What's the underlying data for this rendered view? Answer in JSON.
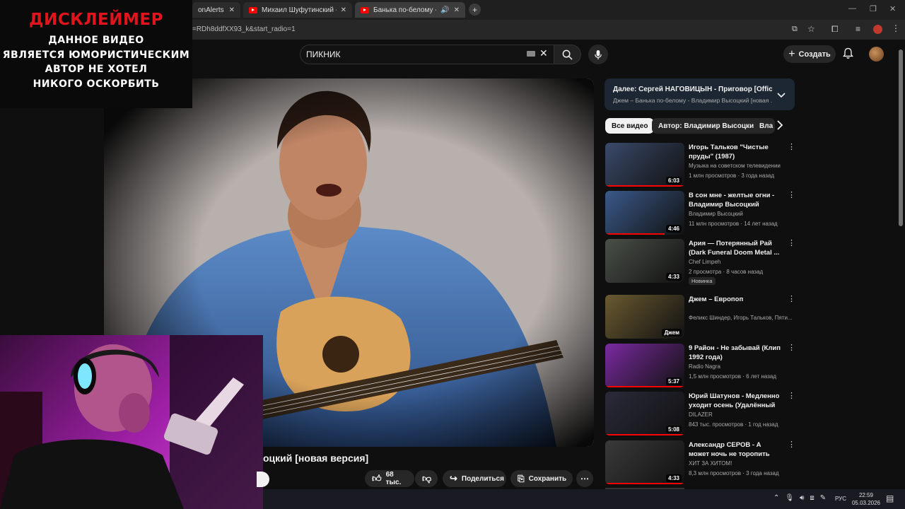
{
  "browser": {
    "tabs": [
      {
        "title": "onAlerts"
      },
      {
        "title": "Михаил Шуфутинский - Еврей"
      },
      {
        "title": "Банька по-белому - Влади"
      }
    ],
    "url": "=RDh8ddfXX93_k&start_radio=1"
  },
  "header": {
    "search_value": "ПИКНИК",
    "create_label": "Создать"
  },
  "overlay": {
    "title": "ДИСКЛЕЙМЕР",
    "lines": [
      "ДАННОЕ ВИДЕО",
      "ЯВЛЯЕТСЯ ЮМОРИСТИЧЕСКИМ",
      "АВТОР НЕ ХОТЕЛ",
      "НИКОГО ОСКОРБИТЬ"
    ]
  },
  "video": {
    "title_visible": "оцкий [новая версия]",
    "likes": "68 тыс.",
    "share_label": "Поделиться",
    "save_label": "Сохранить"
  },
  "up_next": {
    "line1": "Далее: Сергей НАГОВИЦЫН - Приговор [Official ...",
    "line2": "Джем – Банька по-белому - Владимир Высоцкий [новая ..."
  },
  "chips": [
    "Все видео",
    "Автор: Владимир Высоцкий",
    "Вла"
  ],
  "recommendations": [
    {
      "title": "Игорь Тальков \"Чистые пруды\" (1987)",
      "channel": "Музыка на советском телевидении",
      "stats": "1 млн просмотров · 3 года назад",
      "duration": "6:03",
      "progress": 1.0,
      "thumb_color": "#3a4a6a"
    },
    {
      "title": "В сон мне - желтые огни - Владимир Высоцкий Vysotsky",
      "channel": "Владимир Высоцкий",
      "stats": "11 млн просмотров · 14 лет назад",
      "duration": "4:46",
      "progress": 0.75,
      "thumb_color": "#3a5a8a"
    },
    {
      "title": "Ария — Потерянный Рай (Dark Funeral Doom Metal ...",
      "channel": "Chef Limpeh",
      "stats": "2 просмотра · 8 часов назад",
      "badge": "Новинка",
      "duration": "4:33",
      "progress": 0,
      "thumb_color": "#4a5048"
    },
    {
      "title": "Джем – Европоп",
      "channel": "Феликс Шиндер, Игорь Тальков, Пяти...",
      "stats": "",
      "duration": "Джем",
      "progress": 0,
      "thumb_color": "#6a5a30"
    },
    {
      "title": "9 Район - Не забывай (Клип 1992 года)",
      "channel": "Radio Nagra",
      "stats": "1,5 млн просмотров · 6 лет назад",
      "duration": "5:37",
      "progress": 1.0,
      "thumb_color": "#7a2aa0"
    },
    {
      "title": "Юрий Шатунов - Медленно уходит осень (Удалённый ...",
      "channel": "DILAZER",
      "stats": "843 тыс. просмотров · 1 год назад",
      "duration": "5:08",
      "progress": 1.0,
      "thumb_color": "#2a2a3a"
    },
    {
      "title": "Александр СЕРОВ - А может ночь не торопить [Official ...",
      "channel": "ХИТ ЗА ХИТОМ!",
      "stats": "8,3 млн просмотров · 3 года назад",
      "duration": "4:33",
      "progress": 1.0,
      "thumb_color": "#3a3a3a"
    }
  ],
  "taskbar": {
    "lang": "РУС",
    "time": "22:59",
    "date": "05.03.2026"
  }
}
